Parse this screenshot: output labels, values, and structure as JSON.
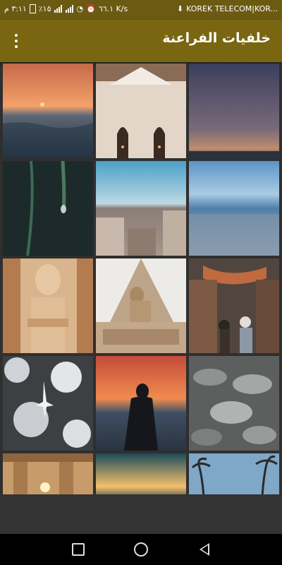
{
  "status_bar": {
    "time": "٣:١١ م",
    "battery": "٪١٥",
    "speed": "٦٦.١ K/s",
    "carrier": "KOREK TELECOM|KOR..."
  },
  "app_bar": {
    "title": "خلفيات الفراعنة",
    "menu_icon": "more-vert-icon"
  },
  "wallpapers": [
    {
      "label": "sunset-sea"
    },
    {
      "label": "white-arches"
    },
    {
      "label": "dusk-horizon"
    },
    {
      "label": "water-drops"
    },
    {
      "label": "city-rooftops"
    },
    {
      "label": "sandy-beach"
    },
    {
      "label": "pharaoh-statue"
    },
    {
      "label": "pyramid-sphinx"
    },
    {
      "label": "market-street"
    },
    {
      "label": "plane-clouds"
    },
    {
      "label": "silhouette-sunset"
    },
    {
      "label": "stones"
    },
    {
      "label": "temple-columns"
    },
    {
      "label": "horizon-glow"
    },
    {
      "label": "palm-trees"
    }
  ],
  "nav_bar": {
    "recents_icon": "square-icon",
    "home_icon": "circle-icon",
    "back_icon": "triangle-back-icon"
  }
}
